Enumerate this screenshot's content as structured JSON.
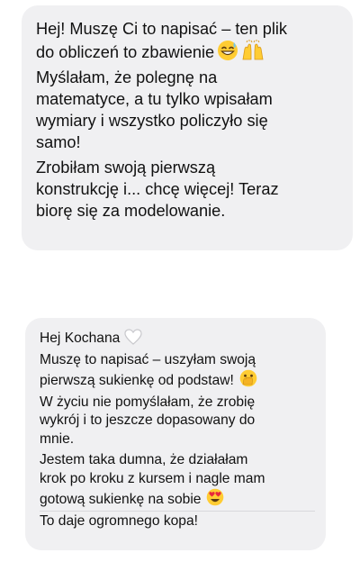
{
  "messages": [
    {
      "lines_p1": [
        "Hej! Muszę Ci to napisać – ten plik",
        "do obliczeń to zbawienie"
      ],
      "lines_p2": [
        "Myślałam, że polegnę na",
        "matematyce, a tu tylko wpisałam",
        "wymiary i wszystko policzyło się",
        "samo!"
      ],
      "lines_p3": [
        "Zrobiłam swoją pierwszą",
        "konstrukcję i... chcę więcej! Teraz",
        "biorę się za modelowanie."
      ],
      "emojis_p1": [
        "sweat-smile-icon",
        "raised-hands-icon"
      ]
    },
    {
      "greeting": "Hej Kochana",
      "greeting_emoji": "white-heart-icon",
      "lines_p1": [
        "Muszę to napisać – uszyłam swoją",
        "pierwszą sukienkę od podstaw!"
      ],
      "emoji_p1": "hand-over-mouth-icon",
      "lines_p2": [
        "W życiu nie pomyślałam, że zrobię",
        "wykrój i to jeszcze dopasowany do",
        "mnie."
      ],
      "lines_p3": [
        "Jestem taka dumna, że działałam",
        "krok po kroku z kursem i nagle mam",
        "gotową sukienkę na sobie"
      ],
      "emoji_p3": "heart-eyes-icon",
      "lines_p4": [
        "To daje ogromnego kopa!"
      ]
    }
  ],
  "colors": {
    "bubble": "#f0f0f2",
    "text": "#111111",
    "emoji_yellow": "#ffcc33",
    "heart_red": "#e8283c"
  }
}
